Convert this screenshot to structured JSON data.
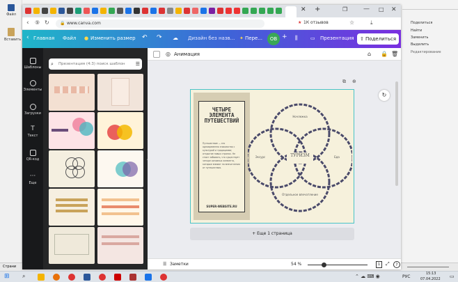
{
  "word": {
    "left_tiles": [
      "Файл",
      "Вставить"
    ],
    "right_rows": [
      "Поделиться",
      "Найти",
      "Заменить",
      "Выделить",
      "Редактирование"
    ],
    "status_left": "Страни"
  },
  "browser": {
    "url": "www.canva.com",
    "reviews": "1К отзывов"
  },
  "canva": {
    "home": "Главная",
    "file": "Файл",
    "resize": "Изменить размер",
    "doc_title": "Дизайн без названия — Презентация (4:3)",
    "doc_title_short": "Дизайн без назв...",
    "pre": "Пере...",
    "avatar": "OB",
    "present": "Презентация",
    "share": "Поделиться",
    "animation": "Анимация"
  },
  "rail": [
    "Шаблоны",
    "Элементы",
    "Загрузки",
    "Текст",
    "QR-код",
    "Еще"
  ],
  "search": {
    "placeholder": "Презентация (4:3) поиск шаблон"
  },
  "slide": {
    "title": "ЧЕТЫРЕ ЭЛЕМЕНТА ПУТЕШЕСТВИЙ",
    "body": "Путешествие — это одновременно знакомство с культурой и традициями; открытие новых странах. Не стоит забывать, что существует четыре основных элемента, которые влияют на впечатления от путешествия.",
    "website": "SUPER-WEBSITE.RU",
    "center": "ТУРИЗМ",
    "labels": {
      "top": "Ночлежка",
      "left": "Эксурс",
      "right": "Еда",
      "bottom": "Отдельное впечатление"
    }
  },
  "more_pages": "+ Еще 1 страница",
  "footer": {
    "notes": "Заметки",
    "zoom": "54 %",
    "page_num": "1",
    "help": "?"
  },
  "taskbar": {
    "lang": "РУС",
    "time": "15:13",
    "date": "07.04.2022"
  }
}
